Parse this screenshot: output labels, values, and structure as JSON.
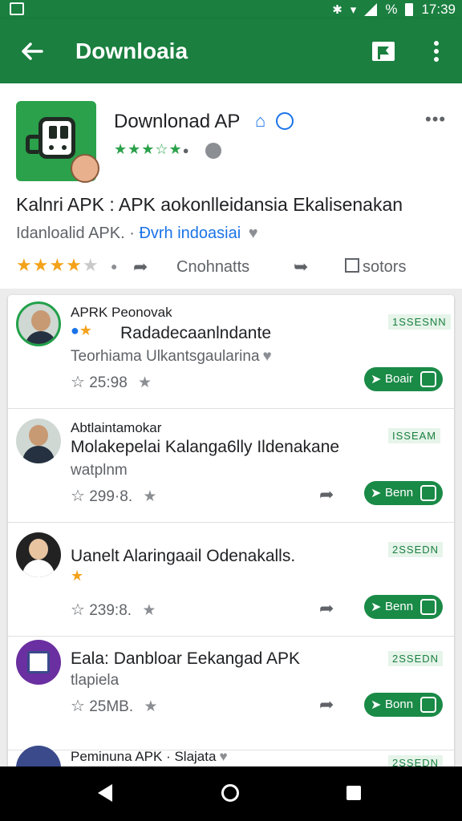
{
  "status_bar": {
    "time": "17:39",
    "battery_symbol": "%"
  },
  "app_bar": {
    "title": "Downloaia"
  },
  "detail": {
    "app_name": "Downlonad AP",
    "headline": "Kalnri APK : APK aokonlleidansia Ekalisenakan",
    "subline_prefix": "Idanloalid APK.",
    "subline_link": "Ðvrh indoasiai",
    "comments_label": "Cnohnatts",
    "filters_label": "sotors"
  },
  "items": [
    {
      "author": "APRK Peonovak",
      "title": "Radadecaanlndante",
      "subtitle": "Teorhiama Ulkantsgaularina",
      "count": "25:98",
      "badge": "1SSESNN",
      "action_label": "Boair"
    },
    {
      "author": "Abtlaintamokar",
      "title": "Molakepelai Kalanga6lly Ildenakane",
      "subtitle": "watplnm",
      "count": "299·8.",
      "badge": "ISSEAM",
      "action_label": "Benn"
    },
    {
      "author": "",
      "title": "Uanelt Alaringaail Odenakalls.",
      "subtitle": "",
      "count": "239:8.",
      "badge": "2SSEDN",
      "action_label": "Benn"
    },
    {
      "author": "",
      "title": "Eala: Danbloar Eekangad APK",
      "subtitle": "tlapiela",
      "count": "25MB.",
      "badge": "2SSEDN",
      "action_label": "Bonn"
    },
    {
      "author": "Peminuna APK · Slajata",
      "title": "",
      "subtitle": "",
      "count": "",
      "badge": "2SSEDN",
      "action_label": ""
    }
  ],
  "colors": {
    "primary": "#1a7f3f",
    "accent_star": "#f4a21a",
    "link": "#1a73e8"
  },
  "icons": [
    "back-arrow-icon",
    "flag-icon",
    "kebab-icon",
    "home-icon",
    "verified-icon",
    "share-icon",
    "edit-icon",
    "send-icon",
    "star-outline-icon"
  ]
}
